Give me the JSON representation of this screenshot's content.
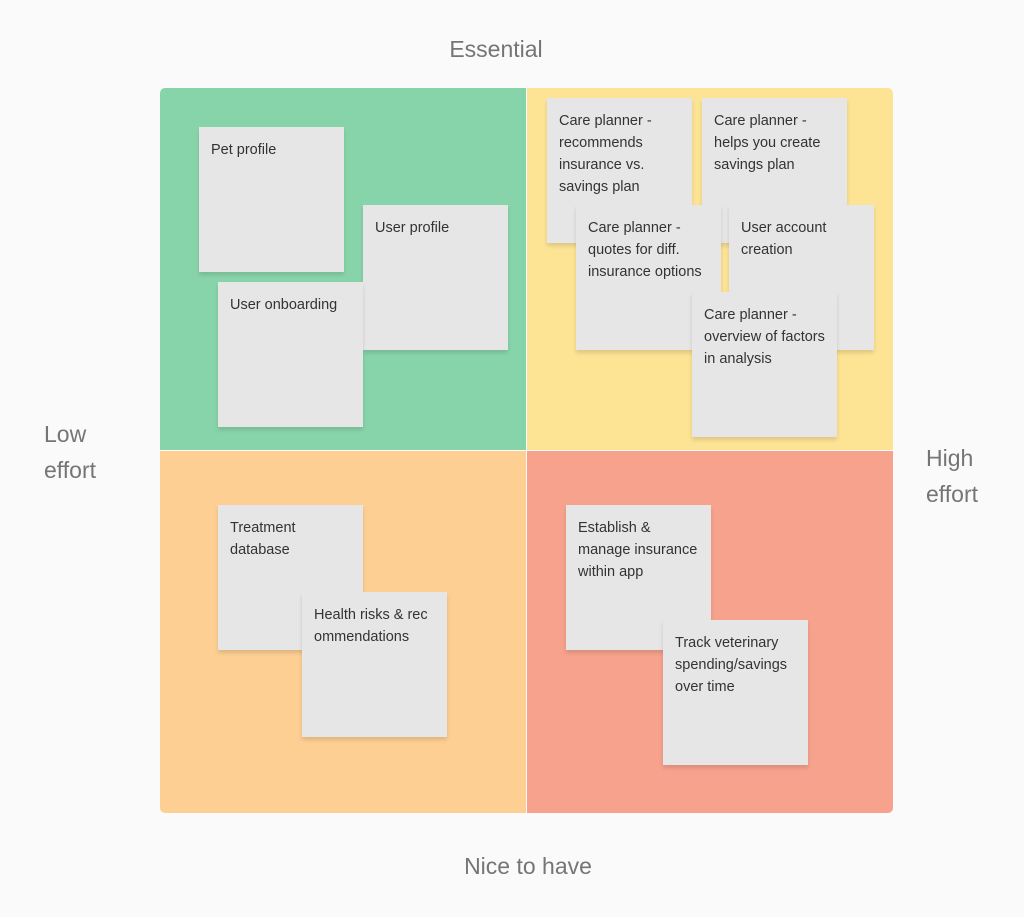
{
  "axes": {
    "top": "Essential",
    "bottom": "Nice to have",
    "left": "Low effort",
    "right": "High effort"
  },
  "colors": {
    "background": "#fafafa",
    "quadrant_essential_low_effort": "#88d4aa",
    "quadrant_essential_high_effort": "#fde394",
    "quadrant_nice_low_effort": "#fdcf92",
    "quadrant_nice_high_effort": "#f6a28d",
    "sticky": "#e6e6e6"
  },
  "quadrants": {
    "essential_low_effort": {
      "stickies": [
        "Pet profile",
        "User profile",
        "User onboarding"
      ]
    },
    "essential_high_effort": {
      "stickies": [
        "Care planner - recommends insurance vs. savings plan",
        "Care planner - helps you create savings plan",
        "Care planner - quotes for diff. insurance options",
        "User account creation",
        "Care planner - overview of factors in analysis"
      ]
    },
    "nice_low_effort": {
      "stickies": [
        "Treatment database",
        "Health risks & recommendations"
      ]
    },
    "nice_high_effort": {
      "stickies": [
        "Establish & manage insurance within app",
        "Track veterinary spending/savings over time"
      ]
    }
  }
}
